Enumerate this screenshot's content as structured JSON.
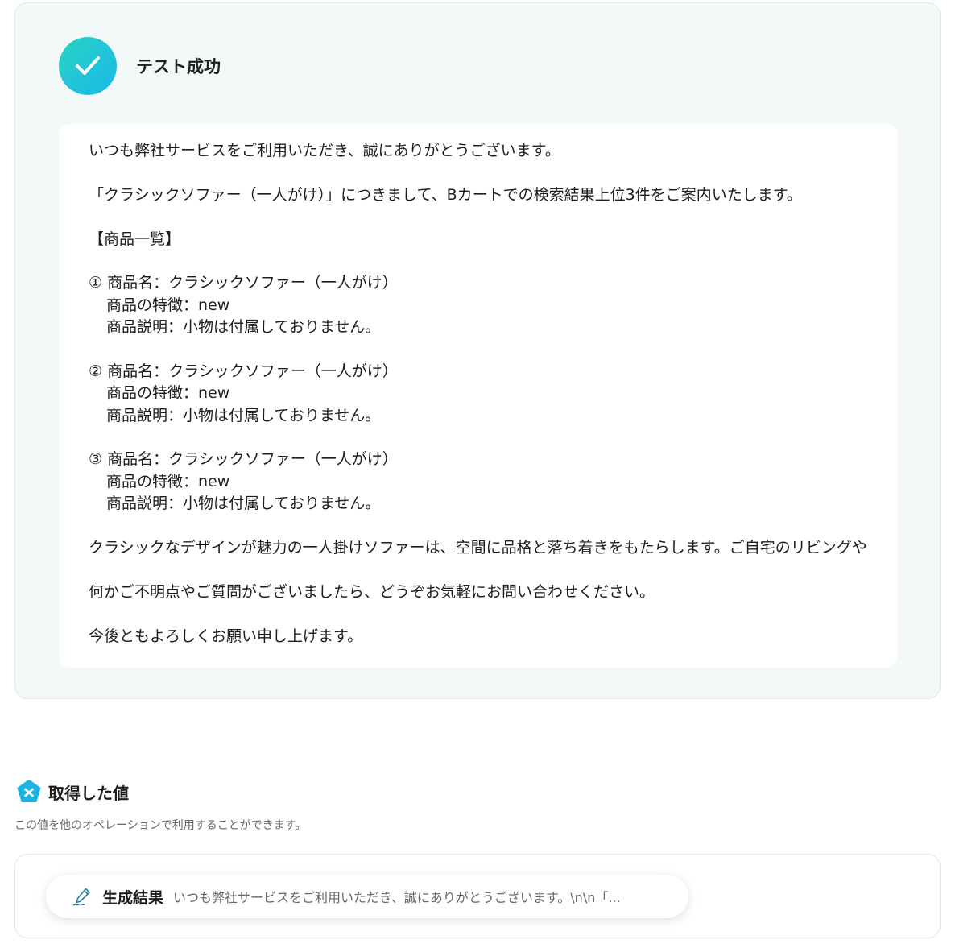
{
  "test_result": {
    "title": "テスト成功",
    "message_lines": [
      {
        "text": "いつも弊社サービスをご利用いただき、誠にありがとうございます。",
        "indent": false
      },
      {
        "text": "",
        "indent": false
      },
      {
        "text": "「クラシックソファー（一人がけ）」につきまして、Bカートでの検索結果上位3件をご案内いたします。",
        "indent": false
      },
      {
        "text": "",
        "indent": false
      },
      {
        "text": "【商品一覧】",
        "indent": false
      },
      {
        "text": "",
        "indent": false
      },
      {
        "text": "① 商品名：クラシックソファー（一人がけ）",
        "indent": false
      },
      {
        "text": "商品の特徴：new",
        "indent": true
      },
      {
        "text": "商品説明：小物は付属しておりません。",
        "indent": true
      },
      {
        "text": "",
        "indent": false
      },
      {
        "text": "② 商品名：クラシックソファー（一人がけ）",
        "indent": false
      },
      {
        "text": "商品の特徴：new",
        "indent": true
      },
      {
        "text": "商品説明：小物は付属しておりません。",
        "indent": true
      },
      {
        "text": "",
        "indent": false
      },
      {
        "text": "③ 商品名：クラシックソファー（一人がけ）",
        "indent": false
      },
      {
        "text": "商品の特徴：new",
        "indent": true
      },
      {
        "text": "商品説明：小物は付属しておりません。",
        "indent": true
      },
      {
        "text": "",
        "indent": false
      },
      {
        "text": "クラシックなデザインが魅力の一人掛けソファーは、空間に品格と落ち着きをもたらします。ご自宅のリビングや",
        "indent": false
      },
      {
        "text": "",
        "indent": false
      },
      {
        "text": "何かご不明点やご質問がございましたら、どうぞお気軽にお問い合わせください。",
        "indent": false
      },
      {
        "text": "",
        "indent": false
      },
      {
        "text": "今後ともよろしくお願い申し上げます。",
        "indent": false
      }
    ]
  },
  "acquired_values": {
    "title": "取得した値",
    "description": "この値を他のオペレーションで利用することができます。",
    "items": [
      {
        "label": "生成結果",
        "value": "いつも弊社サービスをご利用いただき、誠にありがとうございます。\\n\\n「..."
      }
    ]
  },
  "icons": {
    "success": "check-circle-icon",
    "section": "yoom-pentagon-icon",
    "item": "pen-signature-icon"
  },
  "colors": {
    "success_gradient_start": "#2ad3c2",
    "success_gradient_end": "#19b8ea",
    "panel_background": "#f3f8f8",
    "section_icon": "#1bb4e4"
  }
}
